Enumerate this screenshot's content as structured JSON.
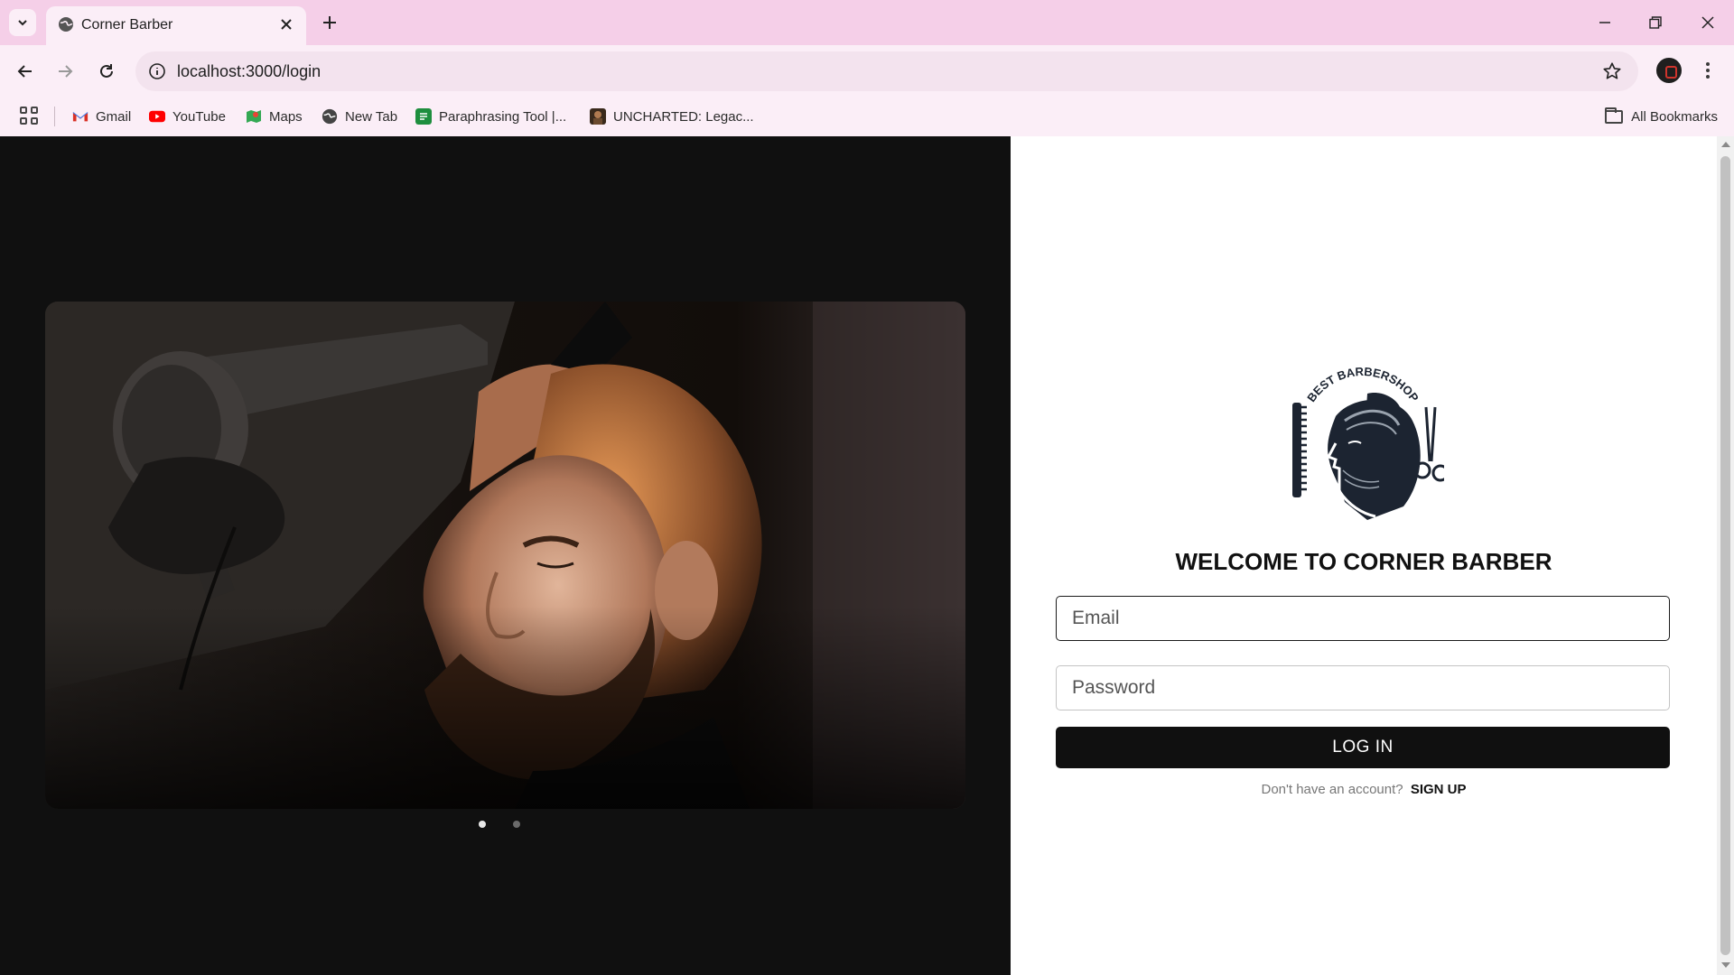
{
  "browser": {
    "tab_title": "Corner Barber",
    "url": "localhost:3000/login",
    "bookmarks": [
      {
        "label": "Gmail",
        "icon": "gmail-icon",
        "color": "#d93025"
      },
      {
        "label": "YouTube",
        "icon": "youtube-icon",
        "color": "#ff0000"
      },
      {
        "label": "Maps",
        "icon": "maps-icon",
        "color": "#34a853"
      },
      {
        "label": "New Tab",
        "icon": "globe-icon",
        "color": "#444444"
      },
      {
        "label": "Paraphrasing Tool |...",
        "icon": "paraphrase-icon",
        "color": "#1e8e3e"
      },
      {
        "label": "UNCHARTED: Legac...",
        "icon": "uncharted-icon",
        "color": "#6b4a2e"
      }
    ],
    "all_bookmarks": "All Bookmarks"
  },
  "hero": {
    "carousel_slide_count": 2,
    "active_slide": 1
  },
  "auth": {
    "logo_text": "BEST BARBERSHOP",
    "heading": "WELCOME TO CORNER BARBER",
    "email_placeholder": "Email",
    "password_placeholder": "Password",
    "login_label": "LOG IN",
    "signup_prompt": "Don't have an account?",
    "signup_label": "SIGN UP"
  },
  "colors": {
    "dark": "#101010",
    "chrome_tab": "#f5cfe8",
    "chrome_bg": "#fbeef7"
  }
}
